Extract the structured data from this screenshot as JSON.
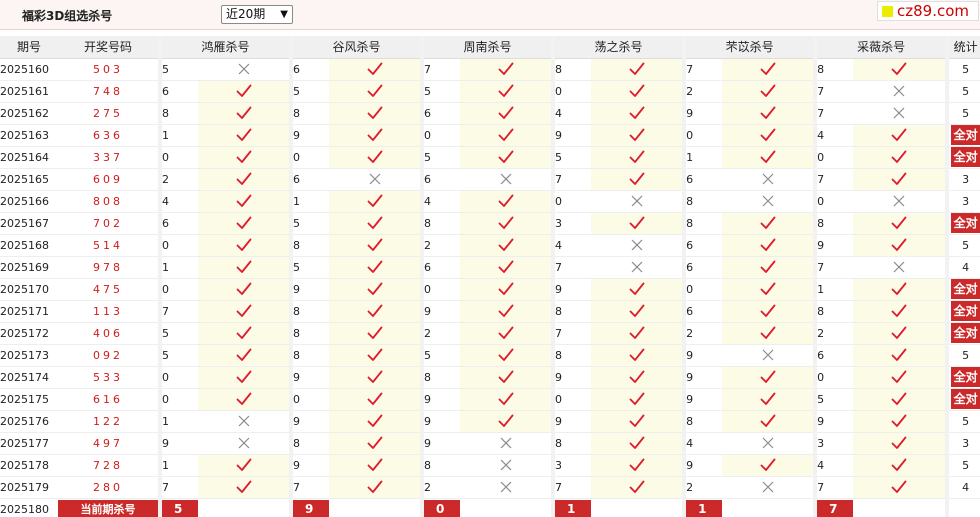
{
  "header": {
    "title": "福彩3D组选杀号",
    "period_select": "近20期",
    "brand": "cz89.com"
  },
  "columns": {
    "period": "期号",
    "draw": "开奖号码",
    "experts": [
      "鸿雁杀号",
      "谷风杀号",
      "周南杀号",
      "荡之杀号",
      "芣苡杀号",
      "采薇杀号"
    ],
    "stat": "统计"
  },
  "rows": [
    {
      "period": "2025160",
      "draw": "503",
      "kills": [
        [
          "5",
          "x"
        ],
        [
          "6",
          "t"
        ],
        [
          "7",
          "t"
        ],
        [
          "8",
          "t"
        ],
        [
          "7",
          "t"
        ],
        [
          "8",
          "t"
        ]
      ],
      "stat": "5"
    },
    {
      "period": "2025161",
      "draw": "748",
      "kills": [
        [
          "6",
          "t"
        ],
        [
          "5",
          "t"
        ],
        [
          "5",
          "t"
        ],
        [
          "0",
          "t"
        ],
        [
          "2",
          "t"
        ],
        [
          "7",
          "x"
        ]
      ],
      "stat": "5"
    },
    {
      "period": "2025162",
      "draw": "275",
      "kills": [
        [
          "8",
          "t"
        ],
        [
          "8",
          "t"
        ],
        [
          "6",
          "t"
        ],
        [
          "4",
          "t"
        ],
        [
          "9",
          "t"
        ],
        [
          "7",
          "x"
        ]
      ],
      "stat": "5"
    },
    {
      "period": "2025163",
      "draw": "636",
      "kills": [
        [
          "1",
          "t"
        ],
        [
          "9",
          "t"
        ],
        [
          "0",
          "t"
        ],
        [
          "9",
          "t"
        ],
        [
          "0",
          "t"
        ],
        [
          "4",
          "t"
        ]
      ],
      "stat": "全对"
    },
    {
      "period": "2025164",
      "draw": "337",
      "kills": [
        [
          "0",
          "t"
        ],
        [
          "0",
          "t"
        ],
        [
          "5",
          "t"
        ],
        [
          "5",
          "t"
        ],
        [
          "1",
          "t"
        ],
        [
          "0",
          "t"
        ]
      ],
      "stat": "全对"
    },
    {
      "period": "2025165",
      "draw": "609",
      "kills": [
        [
          "2",
          "t"
        ],
        [
          "6",
          "x"
        ],
        [
          "6",
          "x"
        ],
        [
          "7",
          "t"
        ],
        [
          "6",
          "x"
        ],
        [
          "7",
          "t"
        ]
      ],
      "stat": "3"
    },
    {
      "period": "2025166",
      "draw": "808",
      "kills": [
        [
          "4",
          "t"
        ],
        [
          "1",
          "t"
        ],
        [
          "4",
          "t"
        ],
        [
          "0",
          "x"
        ],
        [
          "8",
          "x"
        ],
        [
          "0",
          "x"
        ]
      ],
      "stat": "3"
    },
    {
      "period": "2025167",
      "draw": "702",
      "kills": [
        [
          "6",
          "t"
        ],
        [
          "5",
          "t"
        ],
        [
          "8",
          "t"
        ],
        [
          "3",
          "t"
        ],
        [
          "8",
          "t"
        ],
        [
          "8",
          "t"
        ]
      ],
      "stat": "全对"
    },
    {
      "period": "2025168",
      "draw": "514",
      "kills": [
        [
          "0",
          "t"
        ],
        [
          "8",
          "t"
        ],
        [
          "2",
          "t"
        ],
        [
          "4",
          "x"
        ],
        [
          "6",
          "t"
        ],
        [
          "9",
          "t"
        ]
      ],
      "stat": "5"
    },
    {
      "period": "2025169",
      "draw": "978",
      "kills": [
        [
          "1",
          "t"
        ],
        [
          "5",
          "t"
        ],
        [
          "6",
          "t"
        ],
        [
          "7",
          "x"
        ],
        [
          "6",
          "t"
        ],
        [
          "7",
          "x"
        ]
      ],
      "stat": "4"
    },
    {
      "period": "2025170",
      "draw": "475",
      "kills": [
        [
          "0",
          "t"
        ],
        [
          "9",
          "t"
        ],
        [
          "0",
          "t"
        ],
        [
          "9",
          "t"
        ],
        [
          "0",
          "t"
        ],
        [
          "1",
          "t"
        ]
      ],
      "stat": "全对"
    },
    {
      "period": "2025171",
      "draw": "113",
      "kills": [
        [
          "7",
          "t"
        ],
        [
          "8",
          "t"
        ],
        [
          "9",
          "t"
        ],
        [
          "8",
          "t"
        ],
        [
          "6",
          "t"
        ],
        [
          "8",
          "t"
        ]
      ],
      "stat": "全对"
    },
    {
      "period": "2025172",
      "draw": "406",
      "kills": [
        [
          "5",
          "t"
        ],
        [
          "8",
          "t"
        ],
        [
          "2",
          "t"
        ],
        [
          "7",
          "t"
        ],
        [
          "2",
          "t"
        ],
        [
          "2",
          "t"
        ]
      ],
      "stat": "全对"
    },
    {
      "period": "2025173",
      "draw": "092",
      "kills": [
        [
          "5",
          "t"
        ],
        [
          "8",
          "t"
        ],
        [
          "5",
          "t"
        ],
        [
          "8",
          "t"
        ],
        [
          "9",
          "x"
        ],
        [
          "6",
          "t"
        ]
      ],
      "stat": "5"
    },
    {
      "period": "2025174",
      "draw": "533",
      "kills": [
        [
          "0",
          "t"
        ],
        [
          "9",
          "t"
        ],
        [
          "8",
          "t"
        ],
        [
          "9",
          "t"
        ],
        [
          "9",
          "t"
        ],
        [
          "0",
          "t"
        ]
      ],
      "stat": "全对"
    },
    {
      "period": "2025175",
      "draw": "616",
      "kills": [
        [
          "0",
          "t"
        ],
        [
          "0",
          "t"
        ],
        [
          "9",
          "t"
        ],
        [
          "0",
          "t"
        ],
        [
          "9",
          "t"
        ],
        [
          "5",
          "t"
        ]
      ],
      "stat": "全对"
    },
    {
      "period": "2025176",
      "draw": "122",
      "kills": [
        [
          "1",
          "x"
        ],
        [
          "9",
          "t"
        ],
        [
          "9",
          "t"
        ],
        [
          "9",
          "t"
        ],
        [
          "8",
          "t"
        ],
        [
          "9",
          "t"
        ]
      ],
      "stat": "5"
    },
    {
      "period": "2025177",
      "draw": "497",
      "kills": [
        [
          "9",
          "x"
        ],
        [
          "8",
          "t"
        ],
        [
          "9",
          "x"
        ],
        [
          "8",
          "t"
        ],
        [
          "4",
          "x"
        ],
        [
          "3",
          "t"
        ]
      ],
      "stat": "3"
    },
    {
      "period": "2025178",
      "draw": "728",
      "kills": [
        [
          "1",
          "t"
        ],
        [
          "9",
          "t"
        ],
        [
          "8",
          "x"
        ],
        [
          "3",
          "t"
        ],
        [
          "9",
          "t"
        ],
        [
          "4",
          "t"
        ]
      ],
      "stat": "5"
    },
    {
      "period": "2025179",
      "draw": "280",
      "kills": [
        [
          "7",
          "t"
        ],
        [
          "7",
          "t"
        ],
        [
          "2",
          "x"
        ],
        [
          "7",
          "t"
        ],
        [
          "2",
          "x"
        ],
        [
          "7",
          "t"
        ]
      ],
      "stat": "4"
    }
  ],
  "current": {
    "period": "2025180",
    "label": "当前期杀号",
    "kills": [
      "5",
      "9",
      "0",
      "1",
      "1",
      "7"
    ]
  },
  "colors": {
    "tick": "#e0192f",
    "cross": "#8a8a8a",
    "highlight": "#cc2a2a",
    "draw_text": "#d11b1b",
    "mark_bg": "#fcfbe5"
  },
  "icons": {
    "tick": "check-icon",
    "cross": "cross-icon"
  }
}
